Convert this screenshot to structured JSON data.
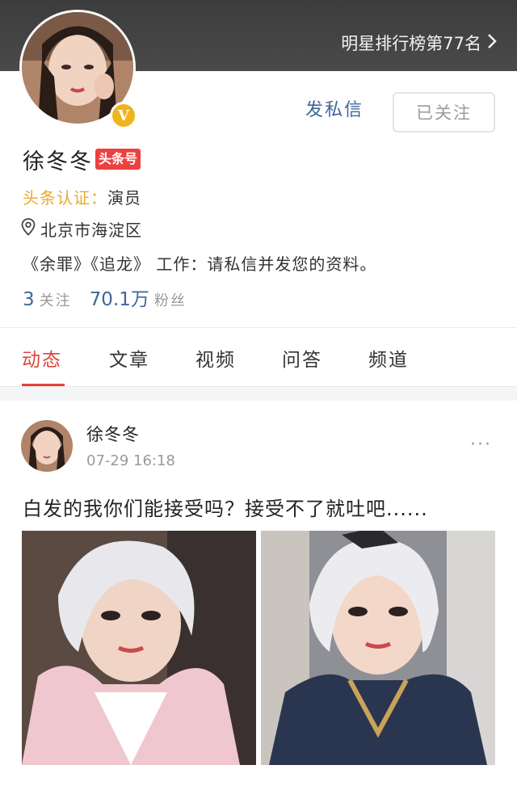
{
  "header": {
    "rank_text": "明星排行榜第77名",
    "rank_chevron": "›"
  },
  "profile": {
    "verified_mark": "V",
    "message_label": "发私信",
    "follow_label": "已关注",
    "name": "徐冬冬",
    "badge": "头条号",
    "cert_label": "头条认证：",
    "cert_value": "演员",
    "location": "北京市海淀区",
    "description": "《余罪》《追龙》 工作：请私信并发您的资料。",
    "following_count": "3",
    "following_label": "关注",
    "fans_count": "70.1万",
    "fans_label": "粉丝"
  },
  "tabs": [
    {
      "label": "动态"
    },
    {
      "label": "文章"
    },
    {
      "label": "视频"
    },
    {
      "label": "问答"
    },
    {
      "label": "频道"
    }
  ],
  "post": {
    "author": "徐冬冬",
    "time": "07-29 16:18",
    "more": "···",
    "text": "白发的我你们能接受吗？接受不了就吐吧......"
  },
  "colors": {
    "accent_red": "#e0453a",
    "link_blue": "#406599",
    "cert_gold": "#e8a92f",
    "badge_red": "#ed4040"
  }
}
